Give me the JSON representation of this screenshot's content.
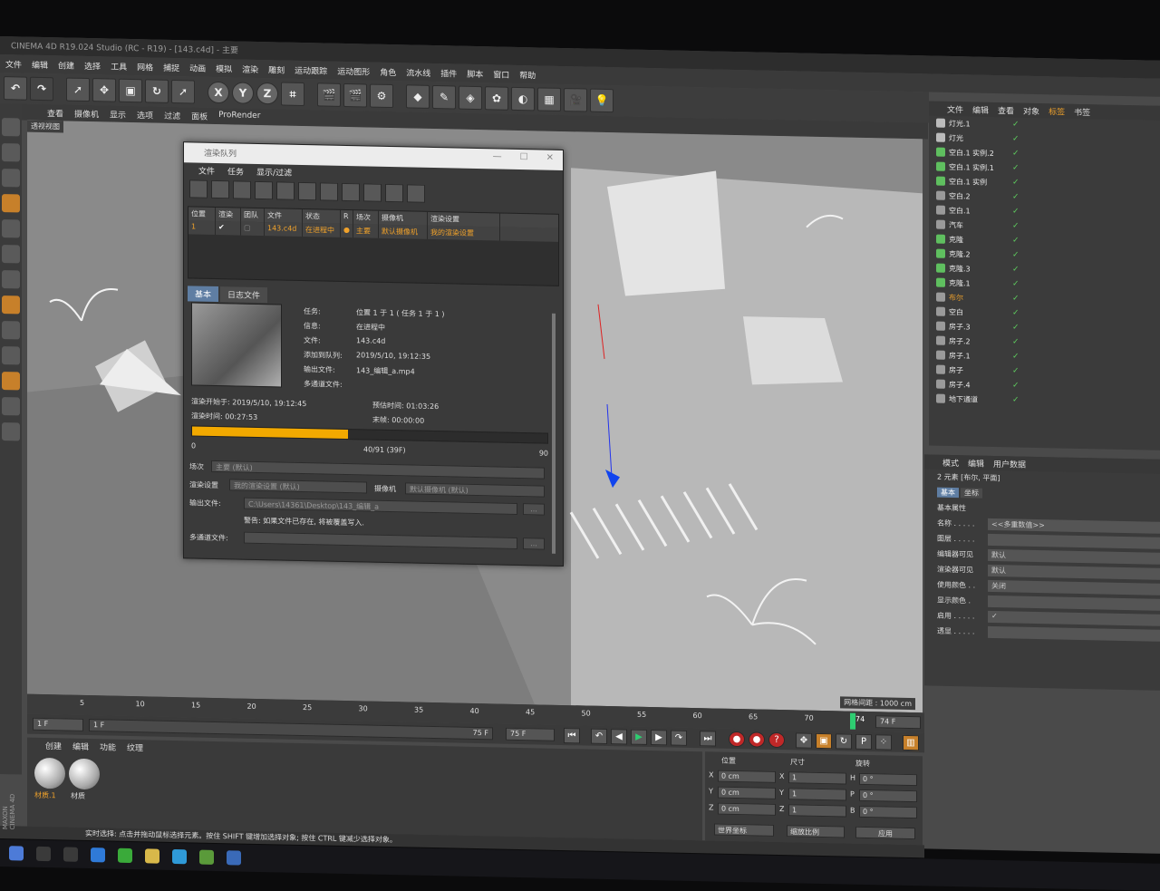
{
  "window": {
    "title": "CINEMA 4D R19.024 Studio (RC - R19) - [143.c4d] - 主要"
  },
  "menubar": [
    "文件",
    "编辑",
    "创建",
    "选择",
    "工具",
    "网格",
    "捕捉",
    "动画",
    "模拟",
    "渲染",
    "雕刻",
    "运动跟踪",
    "运动图形",
    "角色",
    "流水线",
    "插件",
    "脚本",
    "窗口",
    "帮助"
  ],
  "toolbar": {
    "axis_x": "X",
    "axis_y": "Y",
    "axis_z": "Z"
  },
  "viewport": {
    "menu": [
      "查看",
      "摄像机",
      "显示",
      "选项",
      "过滤",
      "面板",
      "ProRender"
    ],
    "label": "透视视图",
    "grid_readout": "网格间距 : 1000 cm"
  },
  "render_queue": {
    "title": "渲染队列",
    "menu": [
      "文件",
      "任务",
      "显示/过滤"
    ],
    "columns": [
      "位置",
      "渲染",
      "团队",
      "文件",
      "状态",
      "R",
      "场次",
      "摄像机",
      "渲染设置"
    ],
    "row": {
      "pos": "1",
      "file": "143.c4d",
      "status": "在进程中",
      "take": "主要",
      "camera": "默认摄像机",
      "settings": "我的渲染设置"
    },
    "tabs": [
      "基本",
      "日志文件"
    ],
    "info": [
      {
        "k": "任务:",
        "v": "位置 1 于 1 ( 任务 1 于 1 )"
      },
      {
        "k": "信息:",
        "v": "在进程中"
      },
      {
        "k": "文件:",
        "v": "143.c4d"
      },
      {
        "k": "添加到队列:",
        "v": "2019/5/10, 19:12:35"
      },
      {
        "k": "输出文件:",
        "v": "143_编辑_a.mp4"
      },
      {
        "k": "多通道文件:",
        "v": ""
      }
    ],
    "render_start_label": "渲染开始于:",
    "render_start": "2019/5/10, 19:12:45",
    "estimate_label": "预估时间:",
    "estimate": "01:03:26",
    "render_time_label": "渲染时间:",
    "render_time": "00:27:53",
    "end_label": "末帧:",
    "end": "00:00:00",
    "progress": 0.44,
    "progress_start": "0",
    "progress_text": "40/91 (39F)",
    "progress_end": "90",
    "take_label": "场次",
    "take_value": "主要 (默认)",
    "settings_label": "渲染设置",
    "settings_value": "我的渲染设置 (默认)",
    "camera_label": "摄像机",
    "camera_value": "默认摄像机 (默认)",
    "output_label": "输出文件:",
    "output_value": "C:\\Users\\14361\\Desktop\\143_编辑_a",
    "warning": "警告: 如果文件已存在, 将被覆盖写入.",
    "multipass_label": "多通道文件:",
    "browse": "..."
  },
  "object_manager": {
    "menu": [
      "文件",
      "编辑",
      "查看",
      "对象",
      "标签",
      "书签"
    ],
    "items": [
      "灯光.1",
      "灯光",
      "空白.1 实例.2",
      "空白.1 实例.1",
      "空白.1 实例",
      "空白.2",
      "空白.1",
      "汽车",
      "克隆",
      "克隆.2",
      "克隆.3",
      "克隆.1",
      "布尔",
      "空白",
      "房子.3",
      "房子.2",
      "房子.1",
      "房子",
      "房子.4",
      "地下通道"
    ],
    "selected": "布尔"
  },
  "attributes": {
    "menu": [
      "模式",
      "编辑",
      "用户数据"
    ],
    "summary": "2 元素 [布尔, 平面]",
    "tabs": [
      "基本",
      "坐标"
    ],
    "section": "基本属性",
    "rows": [
      {
        "k": "名称 . . . . .",
        "v": "<<多重数值>>"
      },
      {
        "k": "图层 . . . . .",
        "v": ""
      },
      {
        "k": "编辑器可见",
        "v": "默认"
      },
      {
        "k": "渲染器可见",
        "v": "默认"
      },
      {
        "k": "使用颜色 . .",
        "v": "关闭"
      },
      {
        "k": "显示颜色 .",
        "v": ""
      },
      {
        "k": "启用 . . . . .",
        "v": "✓"
      },
      {
        "k": "透显 . . . . .",
        "v": ""
      }
    ]
  },
  "timeline": {
    "ticks": [
      "5",
      "10",
      "15",
      "20",
      "25",
      "30",
      "35",
      "40",
      "45",
      "50",
      "55",
      "60",
      "65",
      "70"
    ],
    "current_frame": "74",
    "end_frame_field": "74 F",
    "start_field": "1 F",
    "range_start": "1 F",
    "range_end": "75 F",
    "max_field": "75 F"
  },
  "material_manager": {
    "menu": [
      "创建",
      "编辑",
      "功能",
      "纹理"
    ],
    "materials": [
      "材质.1",
      "材质"
    ]
  },
  "coordinates": {
    "headers": [
      "位置",
      "尺寸",
      "旋转"
    ],
    "rows": [
      {
        "axis": "X",
        "pos": "0 cm",
        "size_axis": "X",
        "size": "1",
        "rot_axis": "H",
        "rot": "0 °"
      },
      {
        "axis": "Y",
        "pos": "0 cm",
        "size_axis": "Y",
        "size": "1",
        "rot_axis": "P",
        "rot": "0 °"
      },
      {
        "axis": "Z",
        "pos": "0 cm",
        "size_axis": "Z",
        "size": "1",
        "rot_axis": "B",
        "rot": "0 °"
      }
    ],
    "mode": "世界坐标",
    "scale": "缩放比例",
    "apply": "应用"
  },
  "status": "实时选择: 点击并拖动鼠标选择元素。按住 SHIFT 键增加选择对象; 按住 CTRL 键减少选择对象。",
  "brand": "MAXON CINEMA 4D",
  "colors": {
    "accent": "#f0a22b",
    "progress": "#f2a900",
    "tab_active": "#5f7ea3"
  }
}
